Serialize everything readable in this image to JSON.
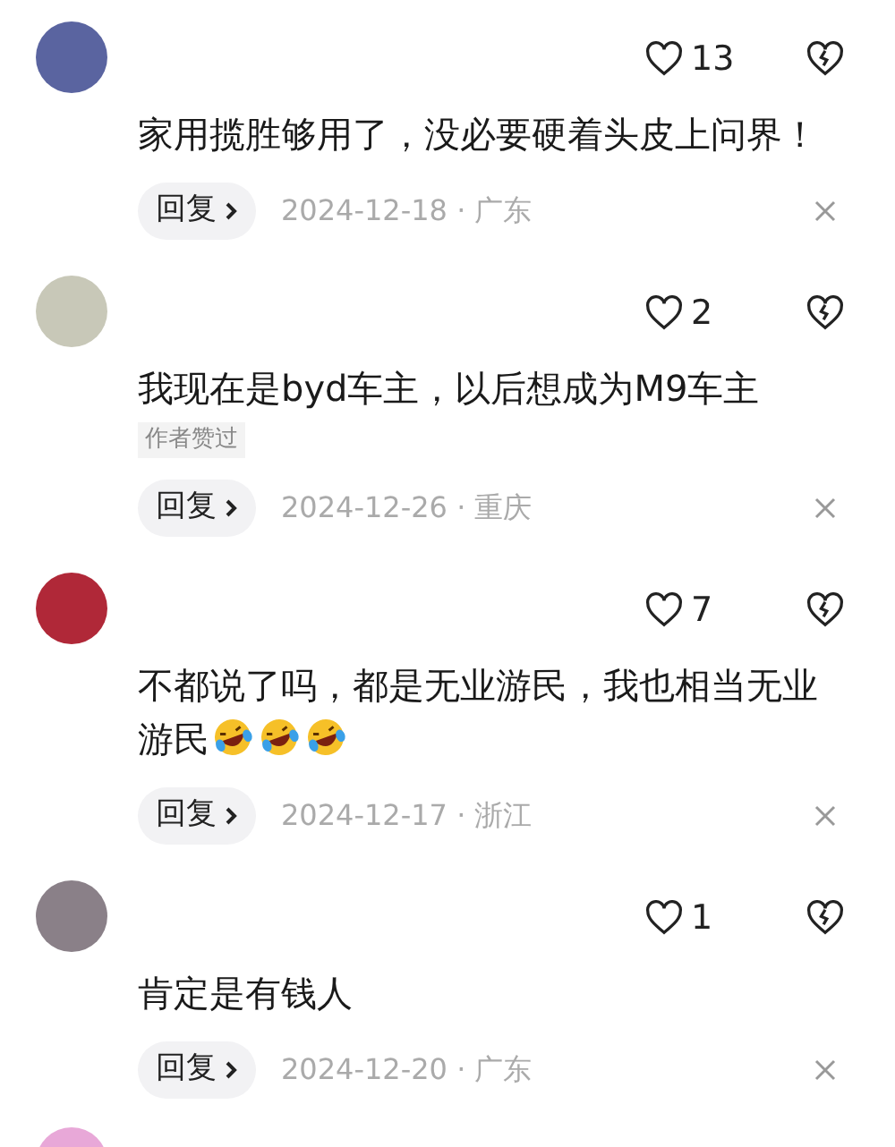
{
  "comments": [
    {
      "avatar": {
        "color": "#5a64a0"
      },
      "likes": "13",
      "text": "家用揽胜够用了，没必要硬着头皮上问界！",
      "reply": "回复",
      "meta": "2024-12-18 · 广东"
    },
    {
      "avatar": {
        "color": "#c8c8b8"
      },
      "likes": "2",
      "text": "我现在是byd车主，以后想成为M9车主",
      "author_liked": "作者赞过",
      "reply": "回复",
      "meta": "2024-12-26 · 重庆"
    },
    {
      "avatar": {
        "color": "#b02838"
      },
      "likes": "7",
      "text": "不都说了吗，都是无业游民，我也相当无业游民",
      "emojis": [
        {
          "kind": "laugh"
        },
        {
          "kind": "laugh"
        },
        {
          "kind": "laugh"
        }
      ],
      "reply": "回复",
      "meta": "2024-12-17 · 浙江"
    },
    {
      "avatar": {
        "color": "#8a8088"
      },
      "likes": "1",
      "text": "肯定是有钱人",
      "reply": "回复",
      "meta": "2024-12-20 · 广东"
    }
  ],
  "next_avatar": {
    "color": "#e8a8d8"
  }
}
